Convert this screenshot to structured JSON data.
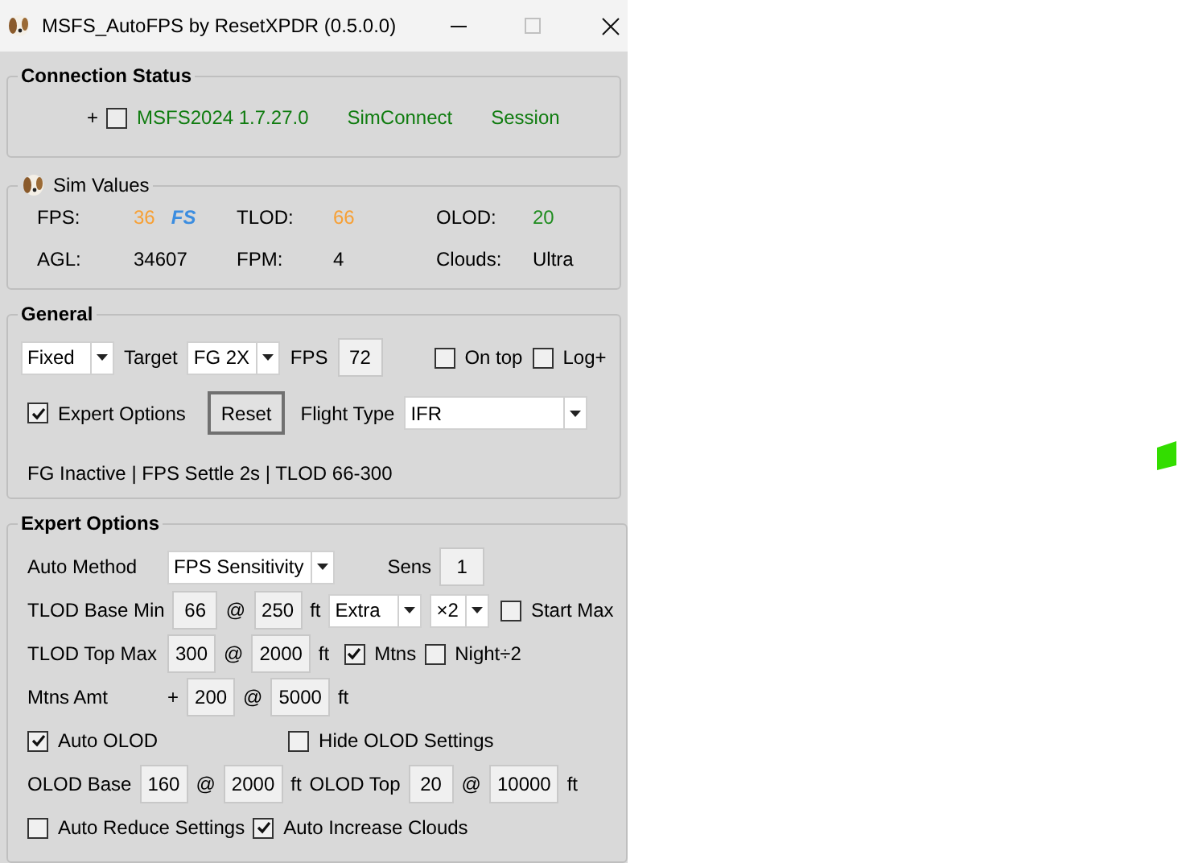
{
  "window": {
    "title": "MSFS_AutoFPS by ResetXPDR (0.5.0.0)"
  },
  "connection_status": {
    "title": "Connection Status",
    "prefix": "+",
    "checked": false,
    "items": [
      "MSFS2024 1.7.27.0",
      "SimConnect",
      "Session"
    ]
  },
  "sim_values": {
    "title": "Sim Values",
    "rows": [
      {
        "label": "FPS:",
        "value": "36",
        "color": "#f7a035",
        "badge": "FS"
      },
      {
        "label": "TLOD:",
        "value": "66",
        "color": "#f7a035"
      },
      {
        "label": "OLOD:",
        "value": "20",
        "color": "#1e8c1e"
      },
      {
        "label": "AGL:",
        "value": "34607",
        "color": "#000000"
      },
      {
        "label": "FPM:",
        "value": "4",
        "color": "#000000"
      },
      {
        "label": "Clouds:",
        "value": "Ultra",
        "color": "#000000"
      }
    ]
  },
  "general": {
    "title": "General",
    "rows": [
      {
        "items": [
          {
            "kind": "dropdown",
            "text": "Fixed"
          },
          {
            "kind": "label",
            "text": "Target"
          },
          {
            "kind": "dropdown",
            "text": "FG 2X"
          },
          {
            "kind": "label",
            "text": "FPS"
          },
          {
            "kind": "field",
            "text": "72"
          },
          {
            "kind": "checkbox",
            "text": "On top",
            "checked": false
          },
          {
            "kind": "checkbox",
            "text": "Log+",
            "checked": false
          }
        ]
      },
      {
        "items": [
          {
            "kind": "checkbox",
            "text": "Expert Options",
            "checked": true
          },
          {
            "kind": "button",
            "text": "Reset"
          },
          {
            "kind": "label",
            "text": "Flight Type"
          },
          {
            "kind": "dropdown",
            "text": "IFR"
          }
        ]
      }
    ],
    "status": "FG Inactive | FPS Settle 2s | TLOD 66-300"
  },
  "expert_options": {
    "title": "Expert Options",
    "rows": [
      {
        "items": [
          {
            "kind": "caption",
            "text": "Auto Method"
          },
          {
            "kind": "dropdown",
            "text": "FPS Sensitivity"
          },
          {
            "kind": "label",
            "text": "Sens"
          },
          {
            "kind": "field",
            "text": "1"
          }
        ]
      },
      {
        "items": [
          {
            "kind": "caption",
            "text": "TLOD Base Min"
          },
          {
            "kind": "field",
            "text": "66"
          },
          {
            "kind": "label",
            "text": "@"
          },
          {
            "kind": "field",
            "text": "250"
          },
          {
            "kind": "label",
            "text": "ft"
          },
          {
            "kind": "dropdown",
            "text": "Extra"
          },
          {
            "kind": "dropdown",
            "text": "×2"
          },
          {
            "kind": "checkbox",
            "text": "Start Max",
            "checked": false
          }
        ]
      },
      {
        "items": [
          {
            "kind": "caption",
            "text": "TLOD Top Max"
          },
          {
            "kind": "field",
            "text": "300"
          },
          {
            "kind": "label",
            "text": "@"
          },
          {
            "kind": "field",
            "text": "2000"
          },
          {
            "kind": "label",
            "text": "ft"
          },
          {
            "kind": "checkbox",
            "text": "Mtns",
            "checked": true
          },
          {
            "kind": "checkbox",
            "text": "Night÷2",
            "checked": false
          }
        ]
      },
      {
        "items": [
          {
            "kind": "caption",
            "text": "Mtns Amt"
          },
          {
            "kind": "label",
            "text": "+"
          },
          {
            "kind": "field",
            "text": "200"
          },
          {
            "kind": "label",
            "text": "@"
          },
          {
            "kind": "field",
            "text": "5000"
          },
          {
            "kind": "label",
            "text": "ft"
          }
        ]
      },
      {
        "items": [
          {
            "kind": "checkbox",
            "text": "Auto OLOD",
            "checked": true
          },
          {
            "kind": "checkbox",
            "text": "Hide OLOD Settings",
            "checked": false
          }
        ]
      },
      {
        "items": [
          {
            "kind": "label",
            "text": "OLOD Base"
          },
          {
            "kind": "field",
            "text": "160"
          },
          {
            "kind": "label",
            "text": "@"
          },
          {
            "kind": "field",
            "text": "2000"
          },
          {
            "kind": "label",
            "text": "ft"
          },
          {
            "kind": "label",
            "text": "OLOD Top"
          },
          {
            "kind": "field",
            "text": "20"
          },
          {
            "kind": "label",
            "text": "@"
          },
          {
            "kind": "field",
            "text": "10000"
          },
          {
            "kind": "label",
            "text": "ft"
          }
        ]
      },
      {
        "items": [
          {
            "kind": "checkbox",
            "text": "Auto Reduce Settings",
            "checked": false
          },
          {
            "kind": "checkbox",
            "text": "Auto Increase Clouds",
            "checked": true
          }
        ]
      }
    ]
  }
}
